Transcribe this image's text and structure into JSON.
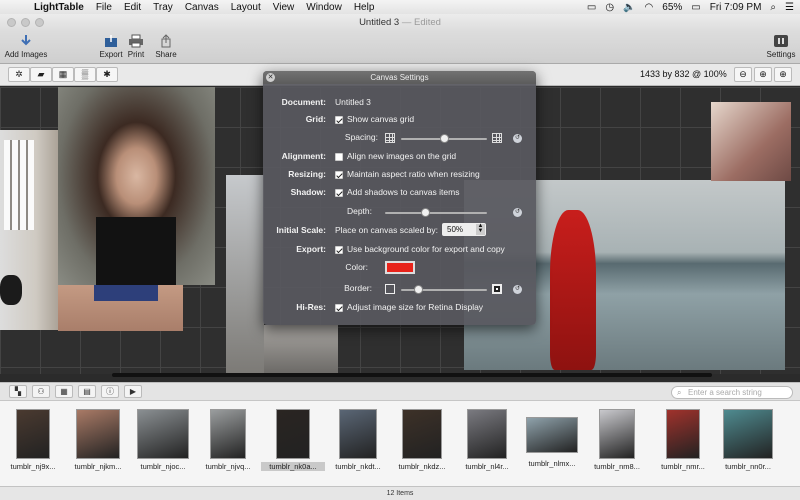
{
  "menubar": {
    "app_name": "LightTable",
    "items": [
      "File",
      "Edit",
      "Tray",
      "Canvas",
      "Layout",
      "View",
      "Window",
      "Help"
    ],
    "battery": "65%",
    "clock": "Fri 7:09 PM"
  },
  "window": {
    "title": "Untitled 3",
    "edited": "— Edited"
  },
  "toolbar": {
    "add_images": "Add Images",
    "export": "Export",
    "print": "Print",
    "share": "Share",
    "settings": "Settings"
  },
  "subbar": {
    "dimensions": "1433 by 832 @ 100%"
  },
  "dialog": {
    "title": "Canvas Settings",
    "document_label": "Document:",
    "document_value": "Untitled 3",
    "grid_label": "Grid:",
    "show_grid": "Show canvas grid",
    "spacing_label": "Spacing:",
    "spacing_level": 0.5,
    "alignment_label": "Alignment:",
    "align_images": "Align new images on the grid",
    "resizing_label": "Resizing:",
    "maintain_aspect": "Maintain aspect ratio when resizing",
    "shadow_label": "Shadow:",
    "add_shadows": "Add shadows to canvas items",
    "depth_label": "Depth:",
    "depth_level": 0.4,
    "initial_scale_label": "Initial Scale:",
    "place_on_canvas": "Place on canvas scaled by:",
    "scale_value": "50%",
    "export_label": "Export:",
    "use_background": "Use background color for export and copy",
    "color_label": "Color:",
    "color_value": "#e8231a",
    "border_label": "Border:",
    "border_level": 0.2,
    "hires_label": "Hi-Res:",
    "adjust_retina": "Adjust image size for Retina Display"
  },
  "search": {
    "placeholder": "Enter a search string"
  },
  "thumbnails": [
    {
      "name": "tumblr_nj9x...",
      "color": "#4a3a30"
    },
    {
      "name": "tumblr_njkm...",
      "color": "#a97a66"
    },
    {
      "name": "tumblr_njoc...",
      "color": "#8a8f92"
    },
    {
      "name": "tumblr_njvq...",
      "color": "#9a9d9e"
    },
    {
      "name": "tumblr_nk0a...",
      "color": "#2a2522"
    },
    {
      "name": "tumblr_nkdt...",
      "color": "#5a6675"
    },
    {
      "name": "tumblr_nkdz...",
      "color": "#3d3128"
    },
    {
      "name": "tumblr_nl4r...",
      "color": "#7a7a80"
    },
    {
      "name": "tumblr_nlmx...",
      "color": "#8fa2ab"
    },
    {
      "name": "tumblr_nm8...",
      "color": "#c9c9cd"
    },
    {
      "name": "tumblr_nmr...",
      "color": "#a0322c"
    },
    {
      "name": "tumblr_nn0r...",
      "color": "#4f8b90"
    }
  ],
  "status": {
    "items_count": "12 Items"
  }
}
